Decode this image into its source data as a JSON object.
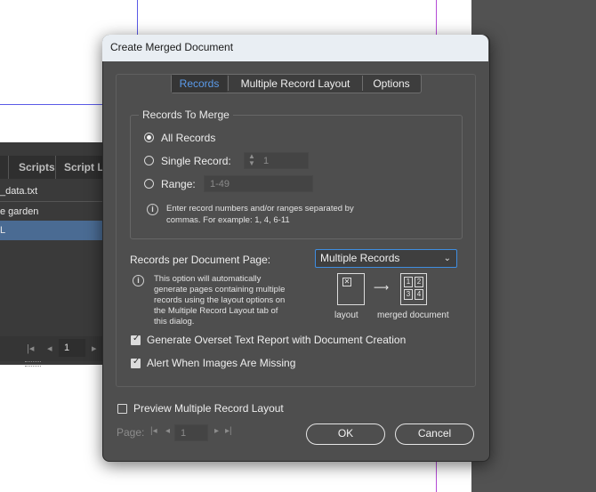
{
  "background": {
    "panel_tabs": [
      "Scripts",
      "Script La"
    ],
    "panel_rows": [
      "_data.txt",
      "e garden",
      "L"
    ],
    "panel_page": "1"
  },
  "dialog": {
    "title": "Create Merged Document",
    "tabs": [
      "Records",
      "Multiple Record Layout",
      "Options"
    ],
    "active_tab": "Records",
    "records_group": {
      "legend": "Records To Merge",
      "all_records": "All Records",
      "single_record": "Single Record:",
      "single_record_value": "1",
      "range": "Range:",
      "range_value": "1-49",
      "hint_line1": "Enter record numbers and/or ranges separated by",
      "hint_line2": "commas. For example: 1, 4, 6-11",
      "selected": "all"
    },
    "records_per_page": {
      "label": "Records per Document Page:",
      "value": "Multiple Records",
      "info_line1": "This option will automatically",
      "info_line2": "generate pages containing multiple",
      "info_line3": "records using the layout options on",
      "info_line4": "the Multiple Record Layout tab of",
      "info_line5": "this dialog.",
      "diagram_layout": "layout",
      "diagram_merged": "merged document",
      "diagram_cells": [
        "1",
        "2",
        "3",
        "4"
      ]
    },
    "checkboxes": {
      "overset": "Generate Overset Text Report with Document Creation",
      "overset_checked": true,
      "images": "Alert When Images Are Missing",
      "images_checked": true
    },
    "preview": {
      "label": "Preview Multiple Record Layout",
      "checked": false,
      "page_label": "Page:",
      "page_value": "1"
    },
    "buttons": {
      "ok": "OK",
      "cancel": "Cancel"
    }
  },
  "colors": {
    "accent": "#3f8de0",
    "active_tab_text": "#5b9bea",
    "dialog_bg": "#4e4e4e",
    "titlebar_bg": "#e9eef3"
  }
}
